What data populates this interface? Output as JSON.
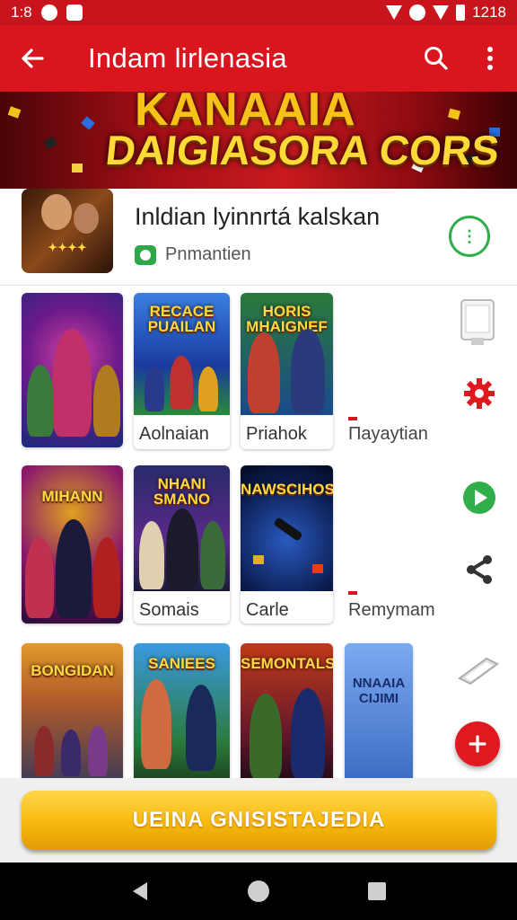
{
  "status_bar": {
    "time_left": "1:8",
    "time_right": "1218"
  },
  "app_bar": {
    "title": "Indam lirlenasia",
    "back_icon": "back-arrow-icon",
    "search_icon": "search-icon",
    "menu_icon": "more-vert-icon"
  },
  "banner": {
    "line1": "KANAAIA",
    "line2": "DAIGIASORA CORS"
  },
  "featured_app": {
    "name": "Inldian lyinnrtá kalskan",
    "subtitle": "Pnmantien",
    "action_icon": "download-circle-icon"
  },
  "grid": {
    "rows": [
      {
        "cards": [
          {
            "art_title": "",
            "label": ""
          },
          {
            "art_title": "RECACE PUAILAN",
            "label": "Aolnaian"
          },
          {
            "art_title": "HORIS MHAIGNEF",
            "label": "Priahok"
          }
        ],
        "side_label": "Паyaytian"
      },
      {
        "cards": [
          {
            "art_title": "MIHANN",
            "label": ""
          },
          {
            "art_title": "NHANI SMANO",
            "label": "Somais"
          },
          {
            "art_title": "NAWSCIHOS",
            "label": "Carle"
          }
        ],
        "side_label": "Remymam"
      },
      {
        "cards": [
          {
            "art_title": "BONGIDAN",
            "label": ""
          },
          {
            "art_title": "SANIEES",
            "label": ""
          },
          {
            "art_title": "SEMONTALS",
            "label": ""
          },
          {
            "art_title": "NNAAIA CIJIMI",
            "label": ""
          }
        ]
      }
    ]
  },
  "side_icons": [
    "phone-icon",
    "gear-icon",
    "play-icon",
    "share-icon",
    "tablet-icon"
  ],
  "cta": {
    "label": "UEINA GNISISTAJEDIA"
  },
  "fab_icon": "plus-icon",
  "nav": [
    "back-triangle-icon",
    "home-circle-icon",
    "recents-square-icon"
  ]
}
